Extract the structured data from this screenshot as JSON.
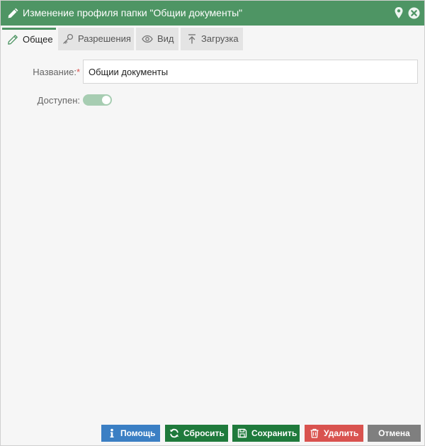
{
  "dialog": {
    "title": "Изменение профиля папки \"Общии документы\"",
    "icons": {
      "title": "pencil-icon",
      "pin": "map-pin-icon",
      "close": "close-circle-icon"
    },
    "colors": {
      "header": "#4e9564",
      "tab_inactive": "#e4e4e4",
      "body": "#f6f6f6",
      "toggle_on": "#a7cdb2"
    }
  },
  "tabs": [
    {
      "label": "Общее",
      "icon": "pencil-icon",
      "active": true
    },
    {
      "label": "Разрешения",
      "icon": "key-icon",
      "active": false
    },
    {
      "label": "Вид",
      "icon": "eye-icon",
      "active": false
    },
    {
      "label": "Загрузка",
      "icon": "upload-icon",
      "active": false
    }
  ],
  "form": {
    "name_label": "Название:",
    "required_mark": "*",
    "name_value": "Общии документы",
    "available_label": "Доступен:",
    "available_on": true
  },
  "buttons": {
    "help": {
      "label": "Помощь",
      "color": "#3b7fc4",
      "icon": "info-icon"
    },
    "reset": {
      "label": "Сбросить",
      "color": "#1f7a3c",
      "icon": "refresh-icon"
    },
    "save": {
      "label": "Сохранить",
      "color": "#1f7a3c",
      "icon": "floppy-icon"
    },
    "delete": {
      "label": "Удалить",
      "color": "#d9534f",
      "icon": "trash-icon"
    },
    "cancel": {
      "label": "Отмена",
      "color": "#7f7f7f"
    }
  }
}
